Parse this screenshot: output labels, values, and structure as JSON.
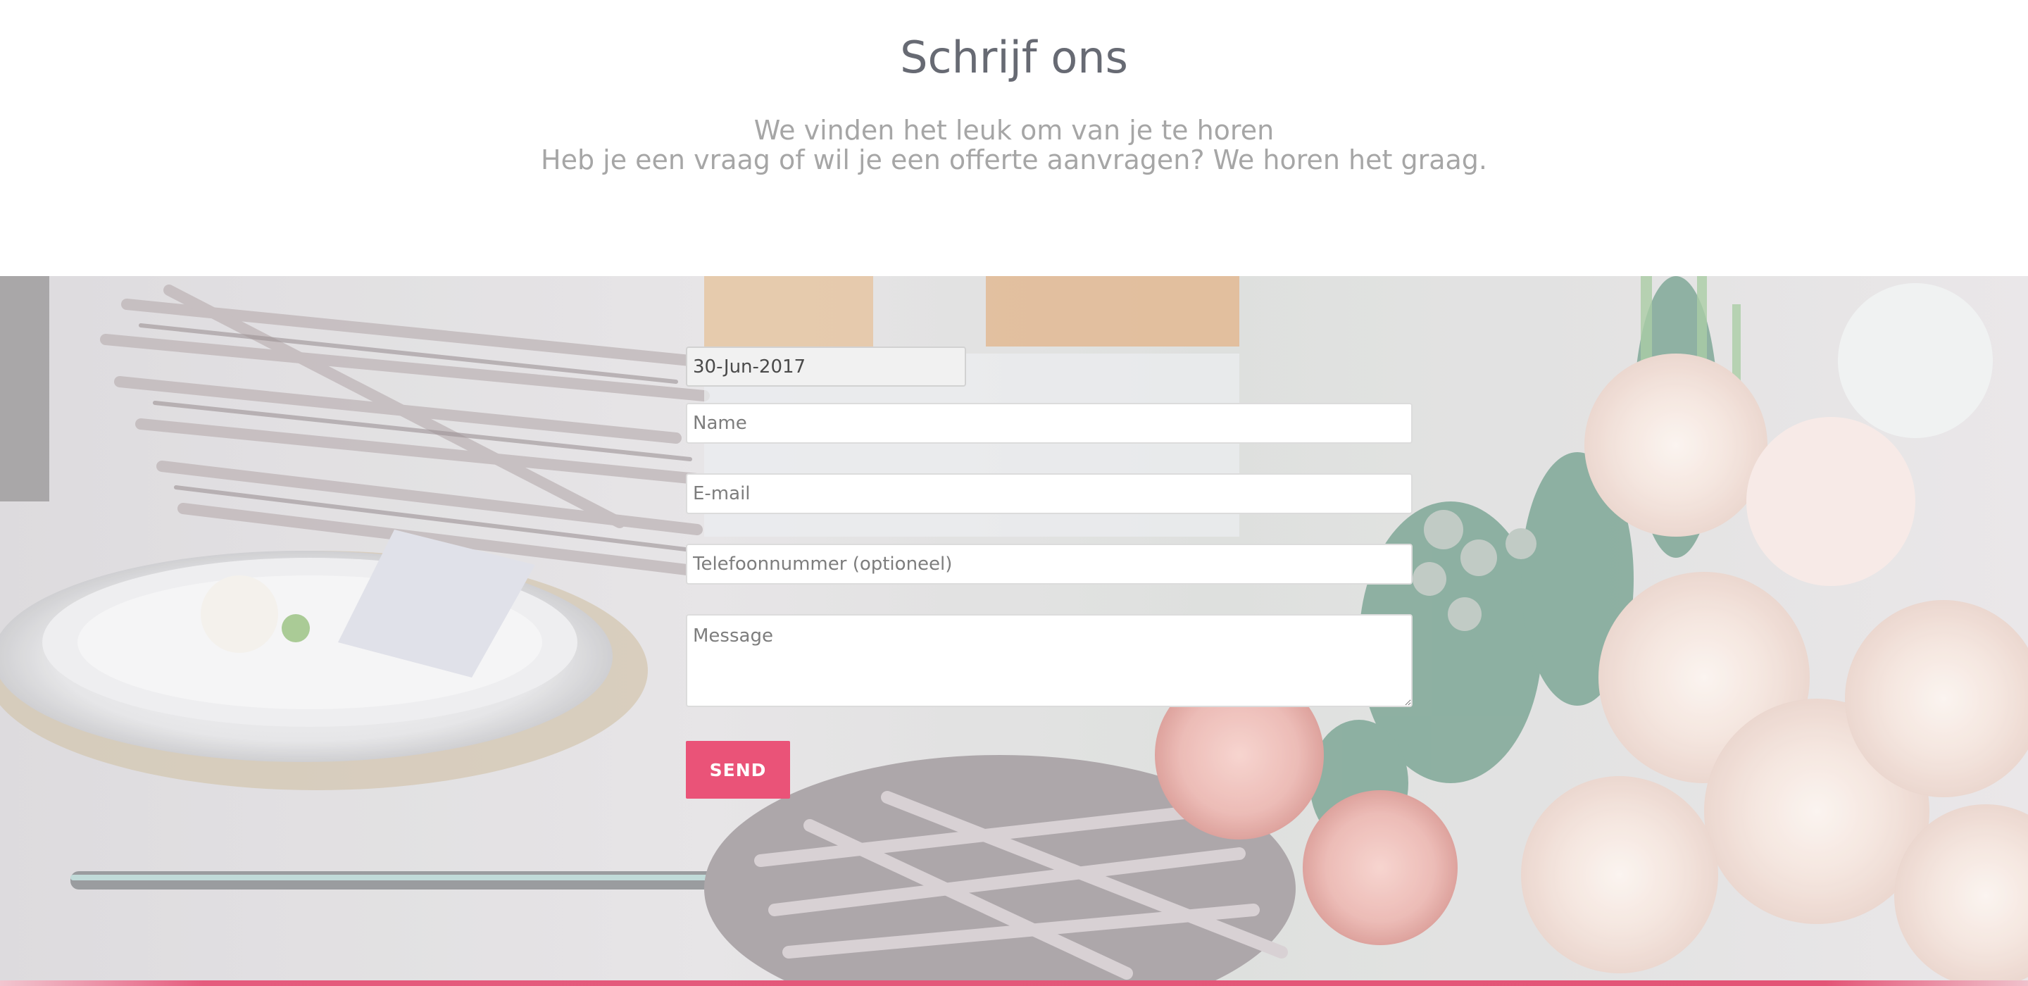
{
  "header": {
    "title": "Schrijf ons",
    "subtitle_line1": "We vinden het leuk om van je te horen",
    "subtitle_line2": "Heb je een vraag of wil je een offerte aanvragen? We horen het graag."
  },
  "form": {
    "date_value": "30-Jun-2017",
    "name_placeholder": "Name",
    "email_placeholder": "E-mail",
    "phone_placeholder": "Telefoonnummer (optioneel)",
    "message_placeholder": "Message",
    "send_label": "SEND"
  },
  "colors": {
    "title": "#676a73",
    "subtitle": "#a6a6a6",
    "accent": "#ea5378"
  }
}
